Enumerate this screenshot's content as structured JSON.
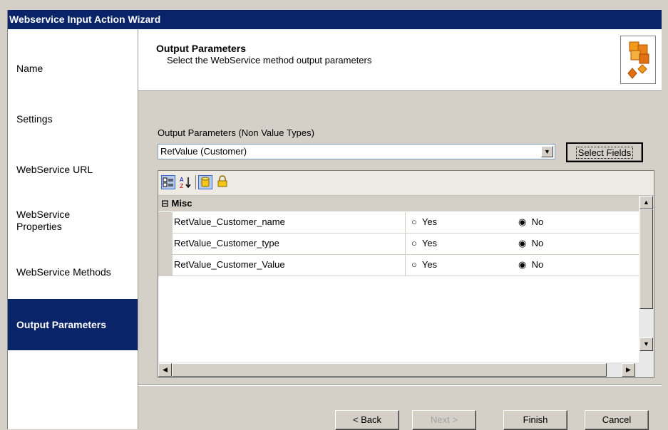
{
  "window": {
    "title": "Webservice Input Action Wizard"
  },
  "sidebar": {
    "items": [
      {
        "label": "Name"
      },
      {
        "label": "Settings"
      },
      {
        "label": "WebService URL"
      },
      {
        "label": "WebService Properties"
      },
      {
        "label": "WebService Methods"
      },
      {
        "label": "Output Parameters",
        "active": true
      }
    ]
  },
  "header": {
    "title": "Output Parameters",
    "subtitle": "Select the WebService method output parameters",
    "logo_icon": "cubes-icon"
  },
  "content": {
    "output_label": "Output Parameters (Non Value Types)",
    "output_combo_value": "RetValue (Customer)",
    "select_fields_label": "Select Fields",
    "grid": {
      "toolbar_icons": [
        "categorized-icon",
        "alphabetical-sort-icon",
        "database-icon",
        "lock-icon"
      ],
      "category": "Misc",
      "rows": [
        {
          "name": "RetValue_Customer_name",
          "yes": "Yes",
          "no": "No",
          "selected": "No"
        },
        {
          "name": "RetValue_Customer_type",
          "yes": "Yes",
          "no": "No",
          "selected": "No"
        },
        {
          "name": "RetValue_Customer_Value",
          "yes": "Yes",
          "no": "No",
          "selected": "No"
        }
      ]
    }
  },
  "footer": {
    "back_label": "< Back",
    "next_label": "Next >",
    "finish_label": "Finish",
    "cancel_label": "Cancel"
  },
  "colors": {
    "titlebar": "#0a246a",
    "active_nav": "#0a246a",
    "dialog": "#d4d0c8"
  }
}
